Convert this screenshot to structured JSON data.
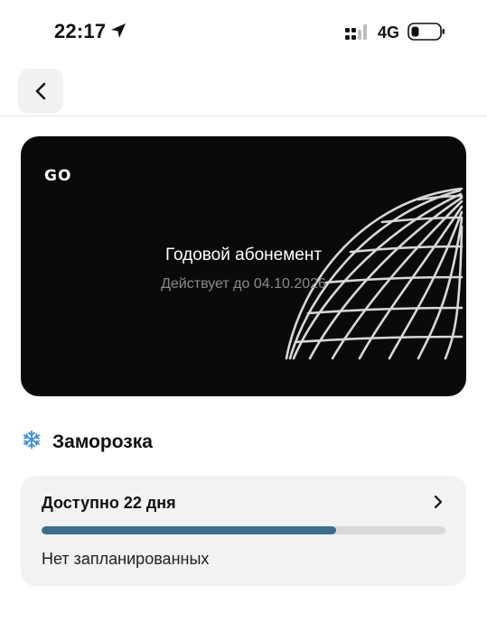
{
  "status_bar": {
    "time": "22:17",
    "network": "4G",
    "location_icon": "location-arrow-icon",
    "signal_icon": "signal-icon",
    "battery_icon": "battery-icon"
  },
  "header": {
    "back_icon": "chevron-left-icon"
  },
  "card": {
    "logo": "GO",
    "title": "Годовой абонемент",
    "subtitle": "Действует до 04.10.2026",
    "background_color": "#0a0a0a"
  },
  "freeze": {
    "icon": "snowflake-icon",
    "title": "Заморозка",
    "available_label": "Доступно 22 дня",
    "progress_fraction": 0.73,
    "progress_color": "#3a6f8f",
    "planned_label": "Нет запланированных"
  }
}
